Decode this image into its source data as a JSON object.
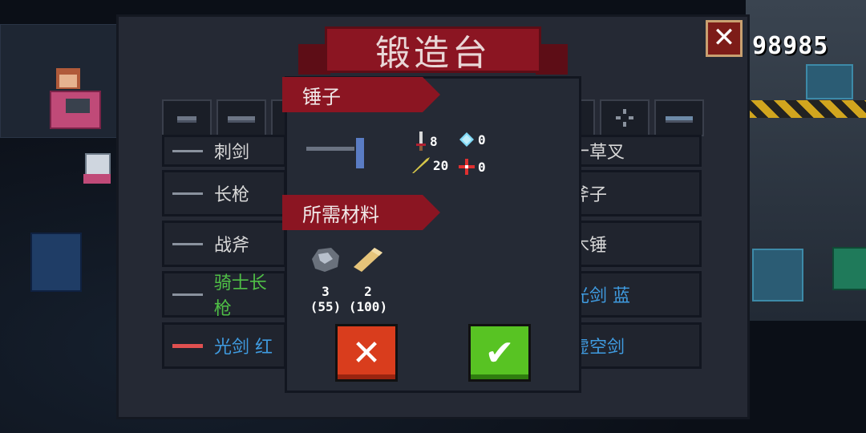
{
  "header": {
    "title": "锻造台",
    "currency": "98985"
  },
  "list": {
    "left": [
      {
        "name": "刺剑",
        "color": "#d8d8d8"
      },
      {
        "name": "长枪",
        "color": "#d8d8d8"
      },
      {
        "name": "战斧",
        "color": "#d8d8d8"
      },
      {
        "name": "骑士长枪",
        "color": "#4fc046"
      },
      {
        "name": "光剑  红",
        "color": "#3f9be0"
      }
    ],
    "right": [
      {
        "name": "十草叉",
        "color": "#d8d8d8"
      },
      {
        "name": "斧子",
        "color": "#d8d8d8"
      },
      {
        "name": "木锤",
        "color": "#d8d8d8"
      },
      {
        "name": "光剑  蓝",
        "color": "#3f9be0"
      },
      {
        "name": "虚空剑",
        "color": "#3f9be0"
      }
    ]
  },
  "popup": {
    "item_name": "锤子",
    "stats": {
      "damage": "8",
      "energy": "0",
      "crit": "20",
      "accuracy": "0"
    },
    "materials_header": "所需材料",
    "materials": [
      {
        "icon": "ore-icon",
        "qty": "3",
        "owned": "(55)"
      },
      {
        "icon": "wood-log-icon",
        "qty": "2",
        "owned": "(100)"
      }
    ]
  }
}
